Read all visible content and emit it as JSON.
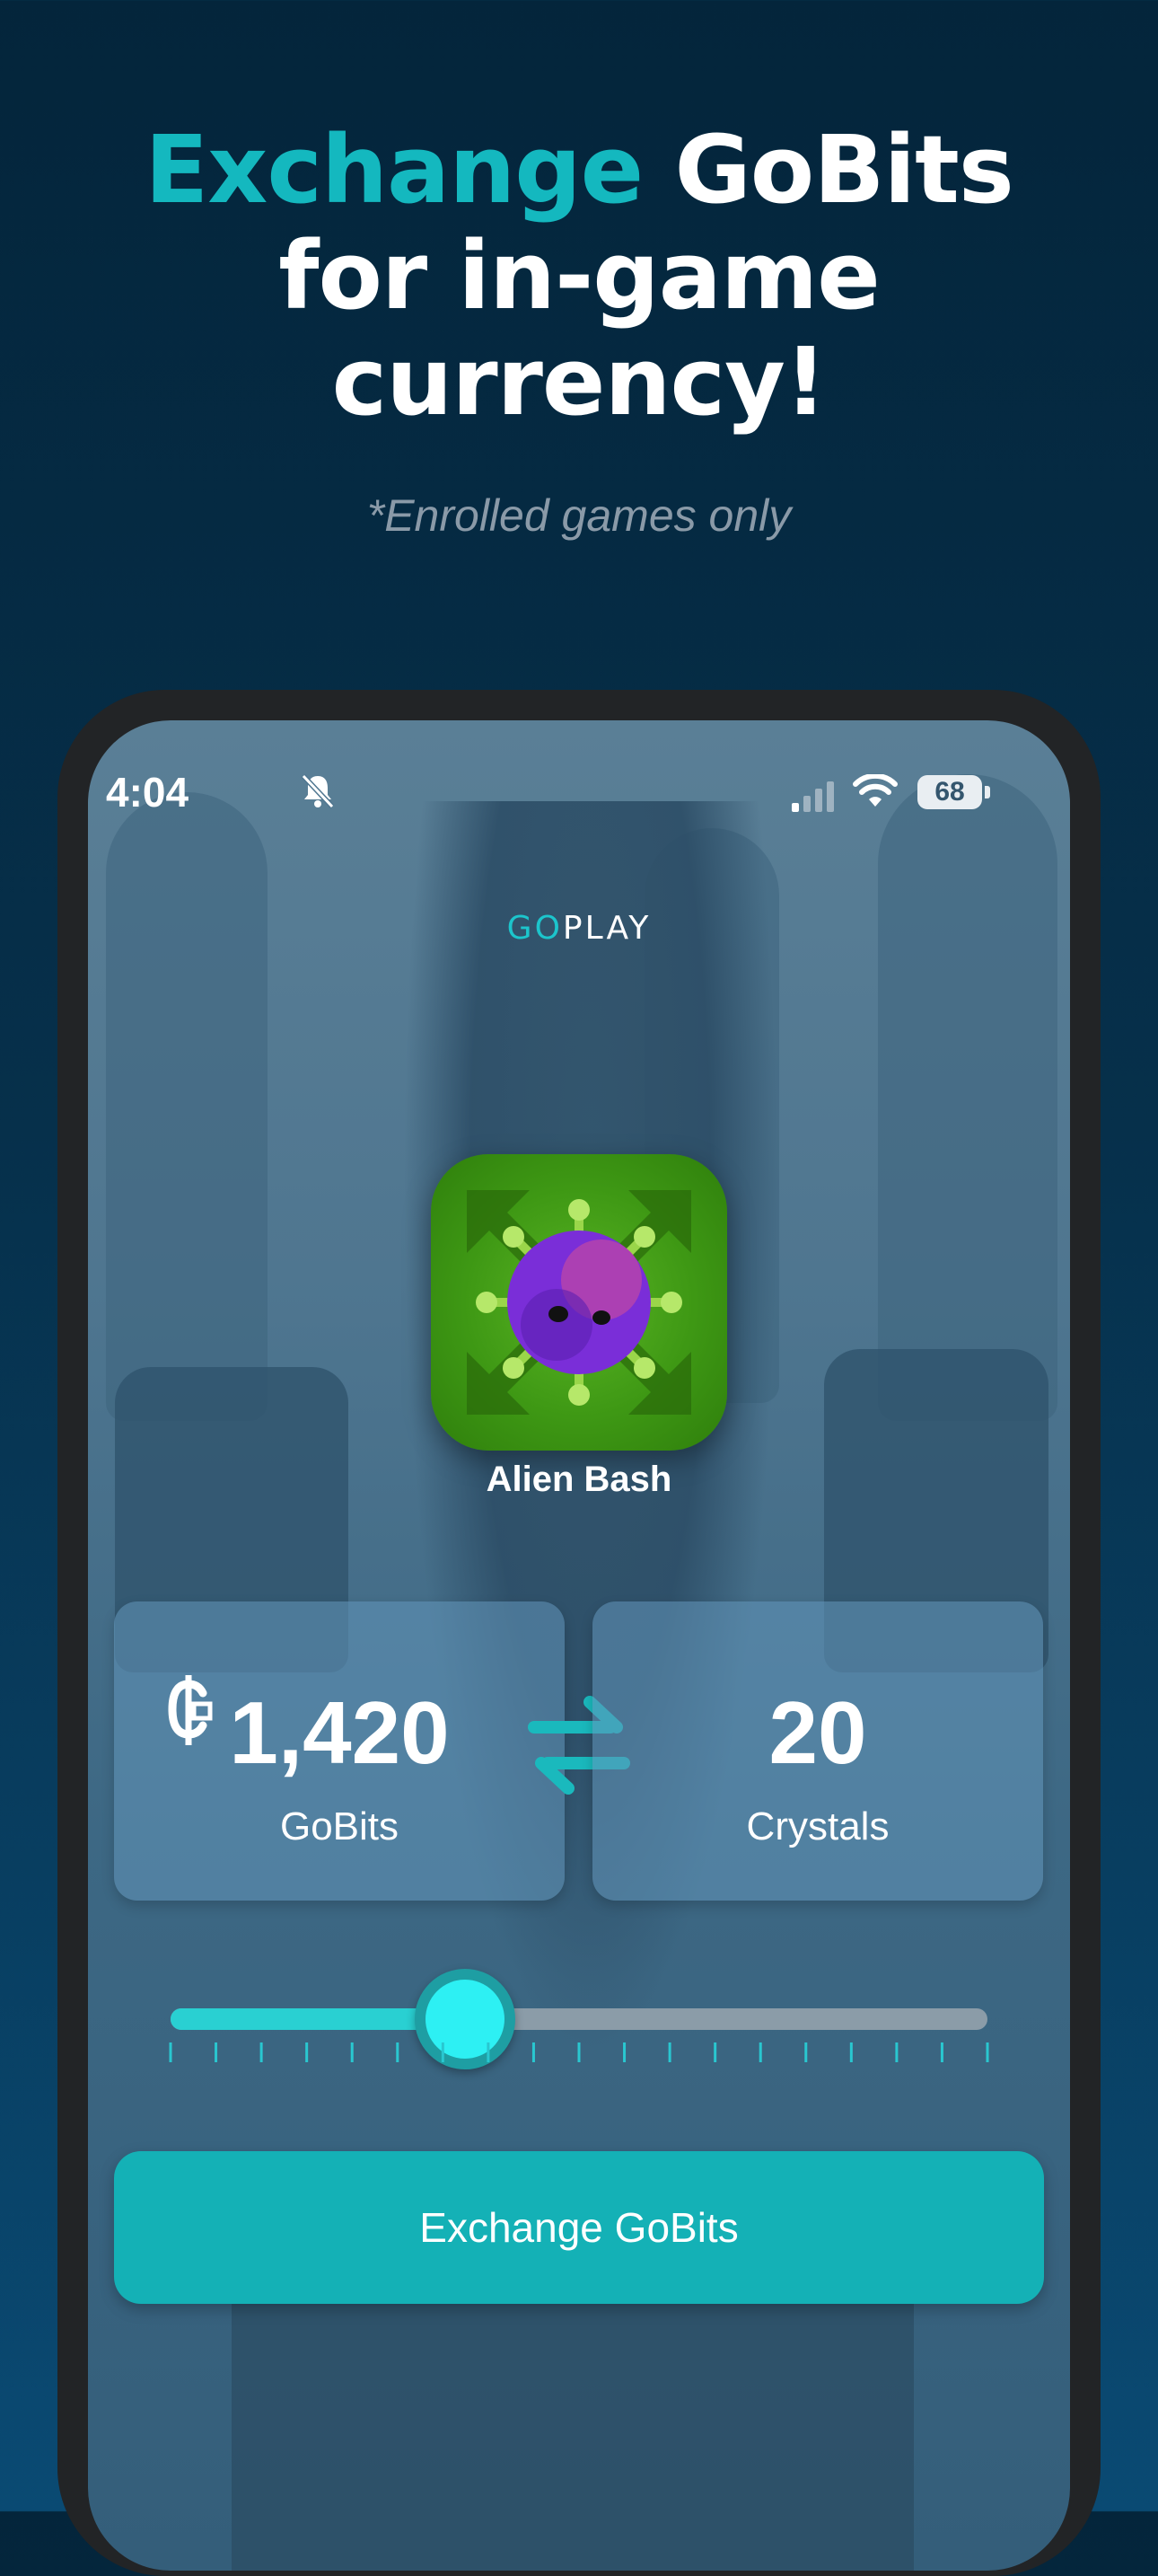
{
  "promo": {
    "title_accent": "Exchange",
    "title_rest_1": "GoBits",
    "title_line_2": "for in-game",
    "title_line_3": "currency!",
    "note": "*Enrolled games only"
  },
  "status_bar": {
    "time": "4:04",
    "battery": "68",
    "icons": [
      "bell-slash-icon",
      "cellular-signal-icon",
      "wifi-icon",
      "battery-icon"
    ]
  },
  "app": {
    "logo_go": "GO",
    "logo_play": "PLAY"
  },
  "game": {
    "name": "Alien Bash",
    "icon": "alien-virus-icon"
  },
  "exchange": {
    "from_value": "1,420",
    "from_label": "GoBits",
    "from_icon": "gobit-currency-icon",
    "to_value": "20",
    "to_label": "Crystals",
    "swap_icon": "swap-arrows-icon",
    "slider_fraction": 0.36,
    "slider_tick_count": 19,
    "button_label": "Exchange GoBits"
  },
  "colors": {
    "accent": "#14b8bf",
    "button": "#14b1b6",
    "thumb": "#2df0f3",
    "background": "#04253b"
  }
}
